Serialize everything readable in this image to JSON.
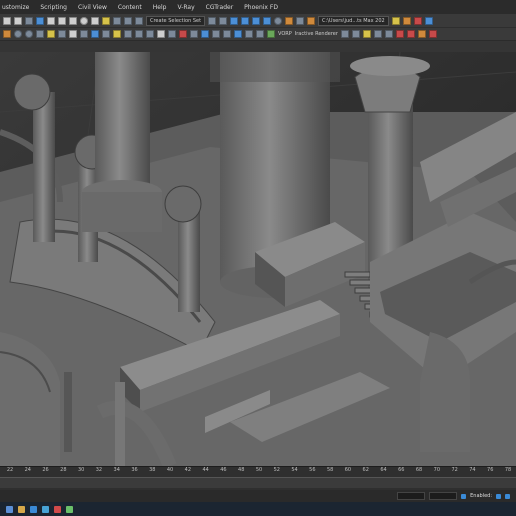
{
  "menu": {
    "items": [
      "ustomize",
      "Scripting",
      "Civil View",
      "Content",
      "Help",
      "V-Ray",
      "CGTrader",
      "Phoenix FD"
    ]
  },
  "toolbar": {
    "selection_set": "Create Selection Set",
    "file_path": "C:\\Users\\jud...ts Max 202",
    "renderer_label": "VORP",
    "active_renderer": "Iractive Renderer"
  },
  "timeline": {
    "ticks": [
      "22",
      "24",
      "26",
      "28",
      "30",
      "32",
      "34",
      "36",
      "38",
      "40",
      "42",
      "44",
      "46",
      "48",
      "50",
      "52",
      "54",
      "56",
      "58",
      "60",
      "62",
      "64",
      "66",
      "68",
      "70",
      "72",
      "74",
      "76",
      "78"
    ]
  },
  "status": {
    "enabled_label": "Enabled:"
  },
  "colors": {
    "viewport_bg": "#2e2e2e",
    "model_gray": "#6f6f6f",
    "accent_blue": "#4c8fd6"
  }
}
